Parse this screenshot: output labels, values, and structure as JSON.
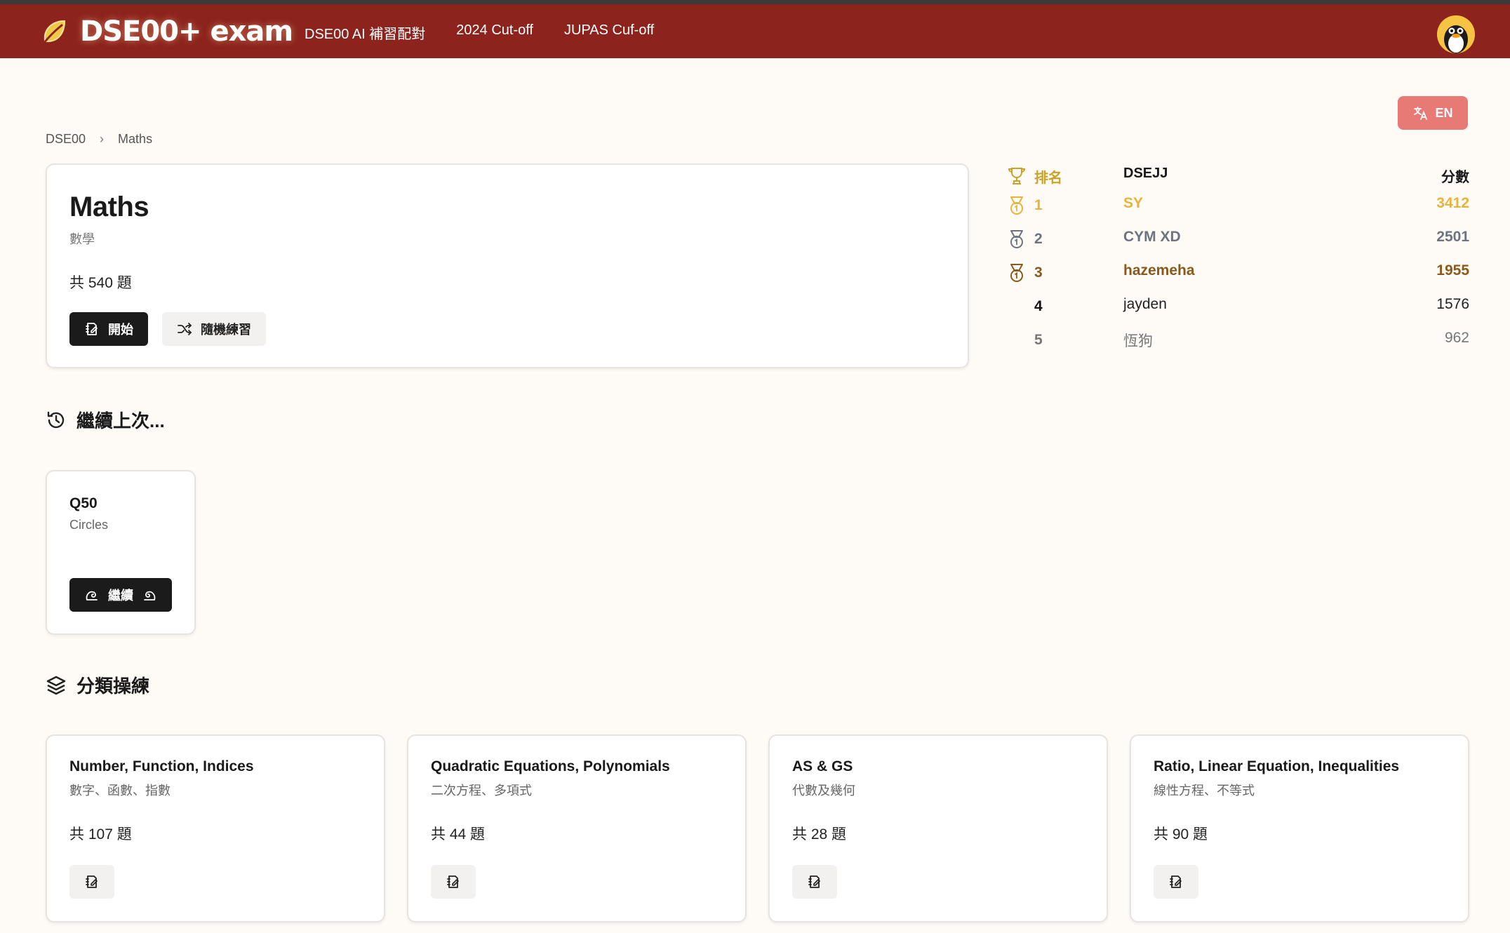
{
  "nav": {
    "brand": "DSE00+ exam",
    "links": [
      "DSE00 AI 補習配對",
      "2024 Cut-off",
      "JUPAS Cuf-off"
    ]
  },
  "lang_button": "EN",
  "breadcrumb": [
    "DSE00",
    "Maths"
  ],
  "subject": {
    "title": "Maths",
    "subtitle": "數學",
    "count": "共 540 題",
    "start_label": "開始",
    "random_label": "隨機練習"
  },
  "ranking": {
    "header": {
      "rank": "排名",
      "name": "DSEJJ",
      "score": "分數"
    },
    "rows": [
      {
        "rank": "1",
        "name": "SY",
        "score": "3412",
        "color": "#e5b53a",
        "medal": "gold"
      },
      {
        "rank": "2",
        "name": "CYM XD",
        "score": "2501",
        "color": "#6c7480",
        "medal": "silver"
      },
      {
        "rank": "3",
        "name": "hazemeha",
        "score": "1955",
        "color": "#8a5a1c",
        "medal": "bronze"
      },
      {
        "rank": "4",
        "name": "jayden",
        "score": "1576",
        "color": "#222222",
        "medal": ""
      },
      {
        "rank": "5",
        "name": "恆狗",
        "score": "962",
        "color": "#777777",
        "medal": ""
      }
    ]
  },
  "continue_section": {
    "title": "繼續上次...",
    "item": {
      "question": "Q50",
      "topic": "Circles",
      "button_label": "繼續"
    }
  },
  "category_section": {
    "title": "分類操練",
    "cards": [
      {
        "title": "Number, Function, Indices",
        "subtitle": "數字、函數、指數",
        "count": "共 107 題"
      },
      {
        "title": "Quadratic Equations, Polynomials",
        "subtitle": "二次方程、多項式",
        "count": "共 44 題"
      },
      {
        "title": "AS & GS",
        "subtitle": "代數及幾何",
        "count": "共 28 題"
      },
      {
        "title": "Ratio, Linear Equation, Inequalities",
        "subtitle": "線性方程、不等式",
        "count": "共 90 題"
      }
    ]
  },
  "colors": {
    "navbar": "#8c241d",
    "page_bg": "#fefaf6",
    "lang_button": "#e77a74",
    "dark_button": "#1b1b1b",
    "rank_header": "#c9a227"
  }
}
